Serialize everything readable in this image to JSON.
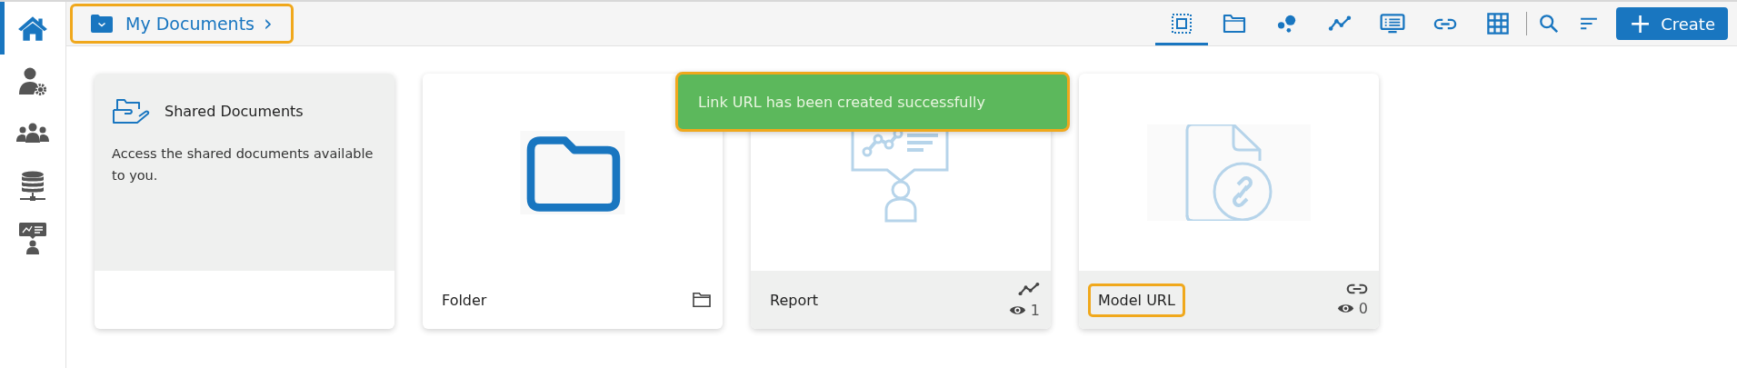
{
  "sidebar": {
    "items": [
      {
        "kind": "home",
        "selected": true
      },
      {
        "kind": "user-settings",
        "selected": false
      },
      {
        "kind": "users",
        "selected": false
      },
      {
        "kind": "database",
        "selected": false
      },
      {
        "kind": "presenter",
        "selected": false
      }
    ]
  },
  "breadcrumb": {
    "label": "My Documents",
    "separator": "›",
    "highlighted": true
  },
  "toolbar": {
    "items": [
      {
        "kind": "select",
        "selected": true
      },
      {
        "kind": "folder",
        "selected": false
      },
      {
        "kind": "bubbles",
        "selected": false
      },
      {
        "kind": "line",
        "selected": false
      },
      {
        "kind": "presentation",
        "selected": false
      },
      {
        "kind": "link",
        "selected": false
      },
      {
        "kind": "grid",
        "selected": false
      }
    ],
    "tools": [
      {
        "kind": "search"
      },
      {
        "kind": "sort"
      }
    ],
    "create_button": {
      "icon": "+",
      "label": "Create"
    }
  },
  "cards": [
    {
      "kind": "shared",
      "title": "Shared Documents",
      "description": "Access the shared documents available to you."
    },
    {
      "kind": "folder",
      "title": "Folder"
    },
    {
      "kind": "report",
      "title": "Report",
      "views": "1"
    },
    {
      "kind": "url",
      "title": "Model URL",
      "views": "0",
      "highlighted": true
    }
  ],
  "toast": {
    "message": "Link URL has been created successfully",
    "highlighted": true
  }
}
